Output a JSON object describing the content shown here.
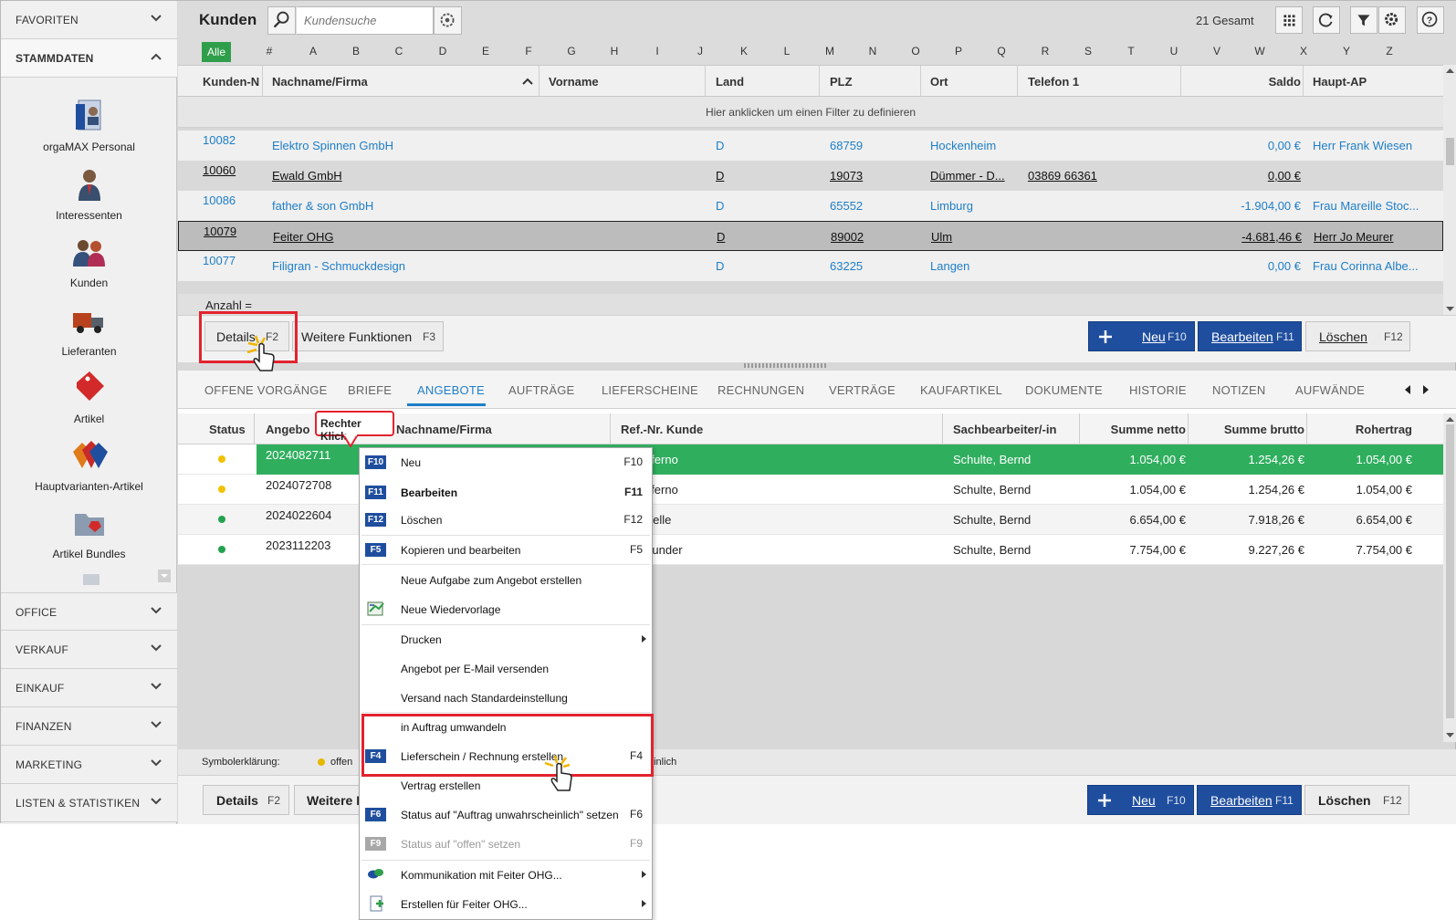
{
  "sidebar": {
    "favoriten": "FAVORITEN",
    "stammdaten": "STAMMDATEN",
    "items": [
      {
        "label": "orgaMAX Personal",
        "icon": "personnel-icon"
      },
      {
        "label": "Interessenten",
        "icon": "person-icon"
      },
      {
        "label": "Kunden",
        "icon": "customers-icon"
      },
      {
        "label": "Lieferanten",
        "icon": "truck-icon"
      },
      {
        "label": "Artikel",
        "icon": "tag-icon"
      },
      {
        "label": "Hauptvarianten-Artikel",
        "icon": "tags-icon"
      },
      {
        "label": "Artikel Bundles",
        "icon": "folder-tag-icon"
      }
    ],
    "sections": [
      "OFFICE",
      "VERKAUF",
      "EINKAUF",
      "FINANZEN",
      "MARKETING",
      "LISTEN & STATISTIKEN"
    ]
  },
  "header": {
    "title": "Kunden",
    "search_placeholder": "Kundensuche",
    "total": "21 Gesamt"
  },
  "alpha": [
    "Alle",
    "#",
    "A",
    "B",
    "C",
    "D",
    "E",
    "F",
    "G",
    "H",
    "I",
    "J",
    "K",
    "L",
    "M",
    "N",
    "O",
    "P",
    "Q",
    "R",
    "S",
    "T",
    "U",
    "V",
    "W",
    "X",
    "Y",
    "Z"
  ],
  "grid": {
    "columns": [
      "Kunden-N",
      "Nachname/Firma",
      "Vorname",
      "Land",
      "PLZ",
      "Ort",
      "Telefon 1",
      "Saldo",
      "Haupt-AP"
    ],
    "filter_hint": "Hier anklicken um einen Filter zu definieren",
    "rows": [
      {
        "nr": "10082",
        "firma": "Elektro Spinnen GmbH",
        "land": "D",
        "plz": "68759",
        "ort": "Hockenheim",
        "tel": "",
        "saldo": "0,00 €",
        "ap": "Herr Frank Wiesen"
      },
      {
        "nr": "10060",
        "firma": "Ewald GmbH",
        "land": "D",
        "plz": "19073",
        "ort": "Dümmer - D...",
        "tel": "03869 66361",
        "saldo": "0,00 €",
        "ap": ""
      },
      {
        "nr": "10086",
        "firma": "father & son GmbH",
        "land": "D",
        "plz": "65552",
        "ort": "Limburg",
        "tel": "",
        "saldo": "-1.904,00 €",
        "ap": "Frau Mareille Stoc..."
      },
      {
        "nr": "10079",
        "firma": "Feiter OHG",
        "land": "D",
        "plz": "89002",
        "ort": "Ulm",
        "tel": "",
        "saldo": "-4.681,46 €",
        "ap": "Herr Jo Meurer"
      },
      {
        "nr": "10077",
        "firma": "Filigran - Schmuckdesign",
        "land": "D",
        "plz": "63225",
        "ort": "Langen",
        "tel": "",
        "saldo": "0,00 €",
        "ap": "Frau Corinna Albe..."
      }
    ],
    "count_label": "Anzahl ="
  },
  "actions": {
    "details": "Details",
    "details_key": "F2",
    "weitere": "Weitere Funktionen",
    "weitere_key": "F3",
    "neu": "Neu",
    "neu_key": "F10",
    "bearbeiten": "Bearbeiten",
    "bearbeiten_key": "F11",
    "loeschen": "Löschen",
    "loeschen_key": "F12",
    "weitere_short": "Weitere F"
  },
  "tabs": [
    "OFFENE VORGÄNGE",
    "BRIEFE",
    "ANGEBOTE",
    "AUFTRÄGE",
    "LIEFERSCHEINE",
    "RECHNUNGEN",
    "VERTRÄGE",
    "KAUFARTIKEL",
    "DOKUMENTE",
    "HISTORIE",
    "NOTIZEN",
    "AUFWÄNDE"
  ],
  "offers": {
    "columns": [
      "Status",
      "Angebo",
      "Nachname/Firma",
      "Ref.-Nr. Kunde",
      "Sachbearbeiter/-in",
      "Summe netto",
      "Summe brutto",
      "Rohertrag"
    ],
    "rows": [
      {
        "status": "yellow",
        "nr": "2024082711",
        "firma": "es Inferno",
        "bearb": "Schulte, Bernd",
        "netto": "1.054,00 €",
        "brutto": "1.254,26 €",
        "roh": "1.054,00 €"
      },
      {
        "status": "yellow",
        "nr": "2024072708",
        "firma": "es Inferno",
        "bearb": "Schulte, Bernd",
        "netto": "1.054,00 €",
        "brutto": "1.254,26 €",
        "roh": "1.054,00 €"
      },
      {
        "status": "green",
        "nr": "2024022604",
        "firma": "ne Welle",
        "bearb": "Schulte, Bernd",
        "netto": "6.654,00 €",
        "brutto": "7.918,26 €",
        "roh": "6.654,00 €"
      },
      {
        "status": "green",
        "nr": "2023112203",
        "firma": "es Wunder",
        "bearb": "Schulte, Bernd",
        "netto": "7.754,00 €",
        "brutto": "9.227,26 €",
        "roh": "7.754,00 €"
      }
    ]
  },
  "legend": {
    "title": "Symbolerklärung:",
    "offen": "offen",
    "tail": "einlich"
  },
  "callout": "Rechter Klick",
  "context_menu": [
    {
      "badge": "F10",
      "label": "Neu",
      "key": "F10"
    },
    {
      "badge": "F11",
      "label": "Bearbeiten",
      "key": "F11"
    },
    {
      "badge": "F12",
      "label": "Löschen",
      "key": "F12"
    },
    {
      "badge": "F5",
      "label": "Kopieren und bearbeiten",
      "key": "F5"
    },
    {
      "badge": "",
      "label": "Neue Aufgabe zum Angebot erstellen",
      "key": ""
    },
    {
      "badge": "",
      "label": "Neue Wiedervorlage",
      "key": ""
    },
    {
      "badge": "",
      "label": "Drucken",
      "key": ""
    },
    {
      "badge": "",
      "label": "Angebot per E-Mail versenden",
      "key": ""
    },
    {
      "badge": "",
      "label": "Versand nach Standardeinstellung",
      "key": ""
    },
    {
      "badge": "",
      "label": "in Auftrag umwandeln",
      "key": ""
    },
    {
      "badge": "F4",
      "label": "Lieferschein / Rechnung erstellen",
      "key": "F4"
    },
    {
      "badge": "",
      "label": "Vertrag erstellen",
      "key": ""
    },
    {
      "badge": "F6",
      "label": "Status auf \"Auftrag unwahrscheinlich\" setzen",
      "key": "F6"
    },
    {
      "badge": "F9",
      "label": "Status auf \"offen\" setzen",
      "key": "F9"
    },
    {
      "badge": "",
      "label": "Kommunikation mit Feiter OHG...",
      "key": ""
    },
    {
      "badge": "",
      "label": "Erstellen für Feiter OHG...",
      "key": ""
    }
  ],
  "colors": {
    "accent": "#1f4e9e",
    "link": "#1e7ec8",
    "highlight": "#2fae5e",
    "alert": "#e3232e"
  }
}
